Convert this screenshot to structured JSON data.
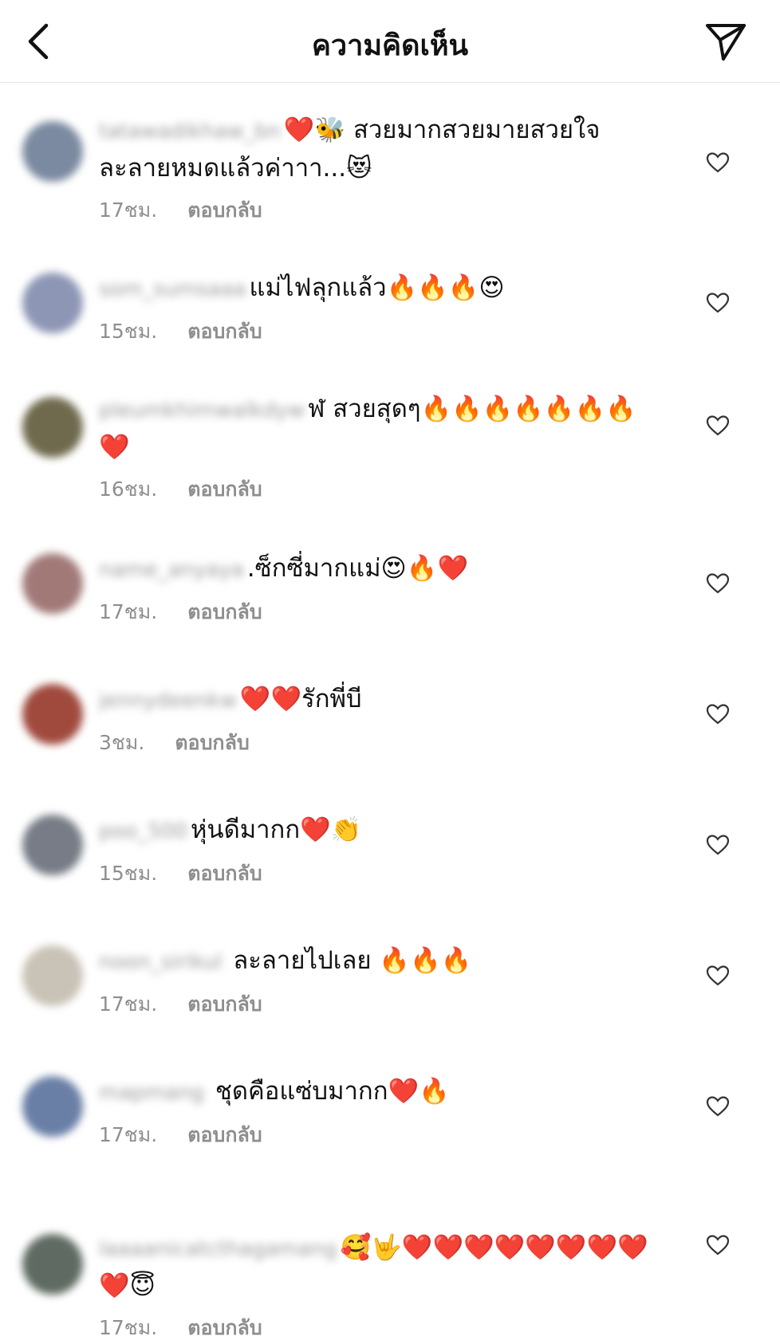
{
  "header": {
    "title": "ความคิดเห็น",
    "back_icon": "chevron-left-icon",
    "share_icon": "send-icon"
  },
  "reply_label": "ตอบกลับ",
  "comments": [
    {
      "username": "tatawadikhaw_bn",
      "text": "❤️🐝 สวยมากสวยมายสวยใจละลายหมดแล้วค่าาา...😻",
      "time": "17ชม.",
      "avatar_color": "#7b8aa0"
    },
    {
      "username": "som_sumsaaa",
      "text": "แม่ไฟลุกแล้ว🔥🔥🔥😍",
      "time": "15ชม.",
      "avatar_color": "#8d96b5"
    },
    {
      "username": "pleumkhimwalkdyw",
      "text": "ฬ สวยสุดๆ🔥🔥🔥🔥🔥🔥🔥❤️",
      "time": "16ชม.",
      "avatar_color": "#6f6a4e"
    },
    {
      "username": "name_anyaya",
      "text": ".ซ็กซี่มากแม่😍🔥❤️",
      "time": "17ชม.",
      "avatar_color": "#a17a78"
    },
    {
      "username": "jennydeenkw",
      "text": "❤️❤️รักพี่บี",
      "time": "3ชม.",
      "avatar_color": "#a04a3d"
    },
    {
      "username": "poo_500",
      "text": "หุ่นดีมากก❤️👏",
      "time": "15ชม.",
      "avatar_color": "#777c86"
    },
    {
      "username": "noon_sirikul",
      "text": " ละลายไปเลย 🔥🔥🔥",
      "time": "17ชม.",
      "avatar_color": "#c9c2b6"
    },
    {
      "username": "mapmang",
      "text": " ชุดคือแซ่บมากก❤️🔥",
      "time": "17ชม.",
      "avatar_color": "#6a7fa6"
    },
    {
      "username": "laaaanicatcthagamang",
      "text": "🥰🤟❤️❤️❤️❤️❤️❤️❤️❤️❤️😇",
      "time": "17ชม.",
      "avatar_color": "#5f6b62"
    }
  ]
}
